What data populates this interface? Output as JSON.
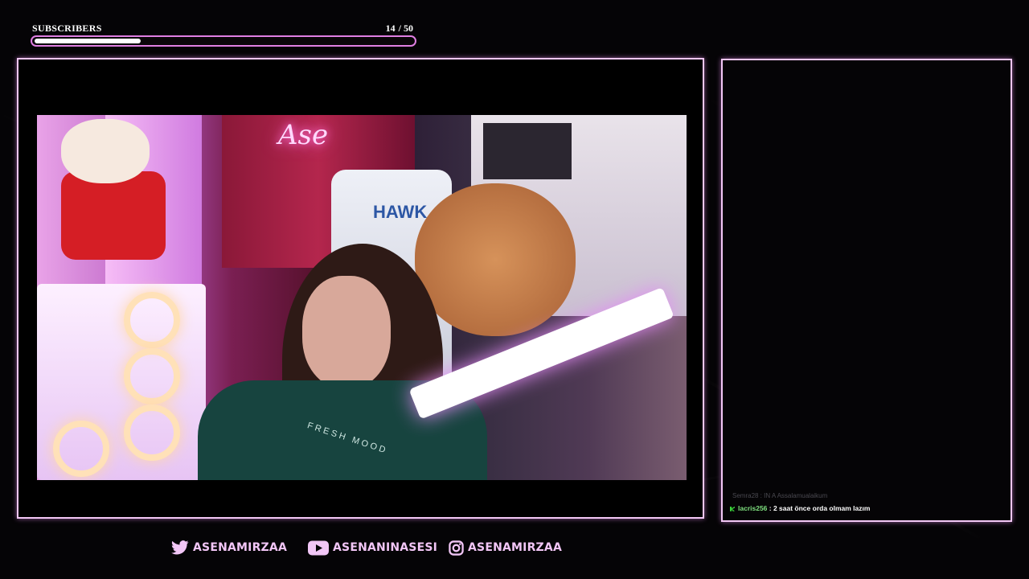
{
  "goal": {
    "title": "SUBSCRIBERS",
    "current": "14",
    "target": "/ 50",
    "progress": 0.28
  },
  "camera": {
    "neon_sign": "Ase",
    "chair_brand": "HAWK",
    "shirt_text": "FRESH MOOD"
  },
  "chat": {
    "faded_message": "Semra28 : IN A Assalamualaikum",
    "messages": [
      {
        "badge": "moderator-badge-icon",
        "user": "lacris256",
        "text": " : 2 saat önce orda olmam lazım"
      }
    ]
  },
  "socials": [
    {
      "icon": "twitter-icon",
      "handle": "ASENAMIRZAA"
    },
    {
      "icon": "youtube-icon",
      "handle": "ASENANINASESI"
    },
    {
      "icon": "instagram-icon",
      "handle": "ASENAMIRZAA"
    }
  ],
  "colors": {
    "accent": "#e07fe2",
    "frame": "#f2c7f5",
    "background": "#050406",
    "social_text": "#f2c6f6"
  }
}
